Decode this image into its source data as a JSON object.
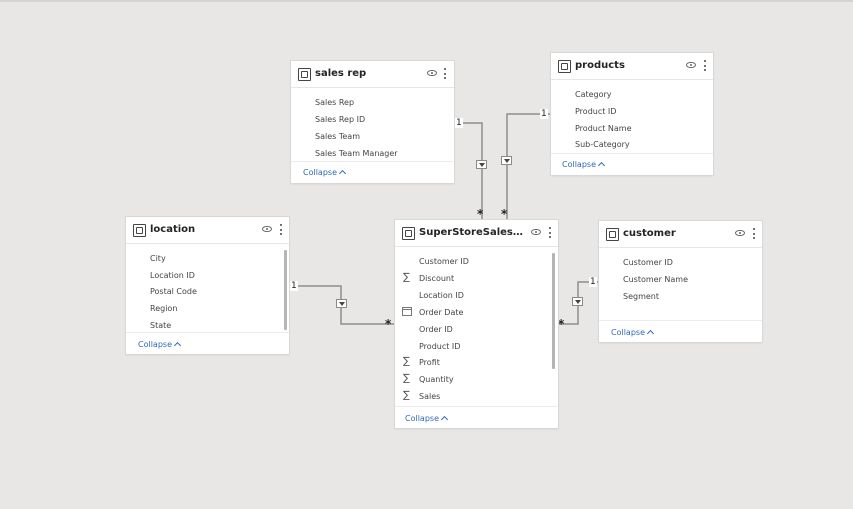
{
  "tables": {
    "sales_rep": {
      "title": "sales rep",
      "fields": [
        "Sales Rep",
        "Sales Rep ID",
        "Sales Team",
        "Sales Team Manager"
      ],
      "collapse": "Collapse"
    },
    "products": {
      "title": "products",
      "fields": [
        "Category",
        "Product ID",
        "Product Name",
        "Sub-Category"
      ],
      "collapse": "Collapse"
    },
    "location": {
      "title": "location",
      "fields": [
        "City",
        "Location ID",
        "Postal Code",
        "Region",
        "State"
      ],
      "collapse": "Collapse"
    },
    "superstore": {
      "title": "SuperStoreSalesData...",
      "fields": [
        "Customer ID",
        "Discount",
        "Location ID",
        "Order Date",
        "Order ID",
        "Product ID",
        "Profit",
        "Quantity",
        "Sales"
      ],
      "collapse": "Collapse"
    },
    "customer": {
      "title": "customer",
      "fields": [
        "Customer ID",
        "Customer Name",
        "Segment"
      ],
      "collapse": "Collapse"
    }
  },
  "relationships": {
    "one": "1",
    "many": "*"
  },
  "icons": {
    "table": "table-icon",
    "visibility": "eye-icon",
    "more": "more-options-icon",
    "sum": "sigma-icon",
    "date": "calendar-icon",
    "filter_direction": "filter-direction-icon"
  },
  "colors": {
    "canvas": "#e8e7e6",
    "link": "#2e6ab5",
    "line": "#8a8a8a"
  }
}
